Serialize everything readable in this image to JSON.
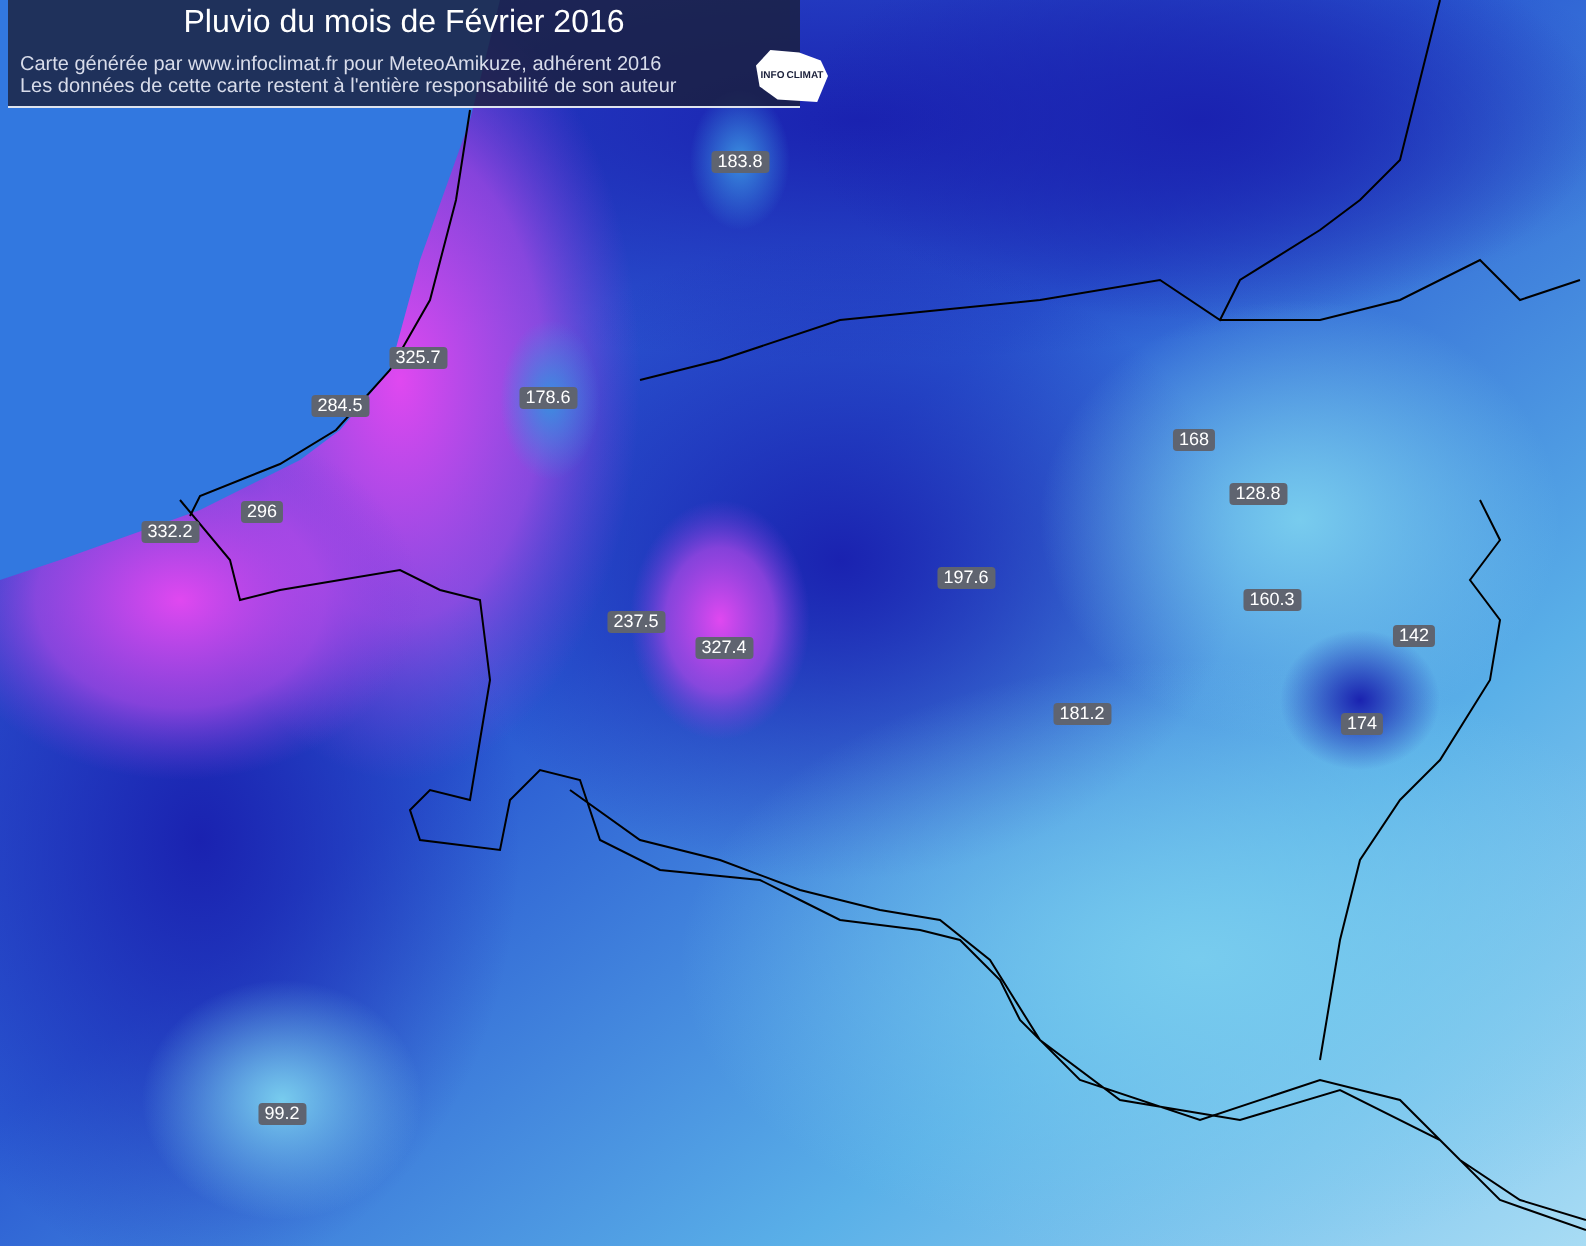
{
  "header": {
    "title": "Pluvio du mois de Février 2016",
    "credit": "Carte générée par www.infoclimat.fr pour MeteoAmikuze, adhérent 2016",
    "disclaimer": "Les données de cette carte restent à l'entière responsabilité de son auteur",
    "logo_text": [
      "INFO",
      "CLIMAT"
    ]
  },
  "stations": [
    {
      "value": "183.8"
    },
    {
      "value": "325.7"
    },
    {
      "value": "284.5"
    },
    {
      "value": "178.6"
    },
    {
      "value": "168"
    },
    {
      "value": "128.8"
    },
    {
      "value": "296"
    },
    {
      "value": "332.2"
    },
    {
      "value": "197.6"
    },
    {
      "value": "160.3"
    },
    {
      "value": "237.5"
    },
    {
      "value": "327.4"
    },
    {
      "value": "142"
    },
    {
      "value": "181.2"
    },
    {
      "value": "174"
    },
    {
      "value": "99.2"
    }
  ]
}
